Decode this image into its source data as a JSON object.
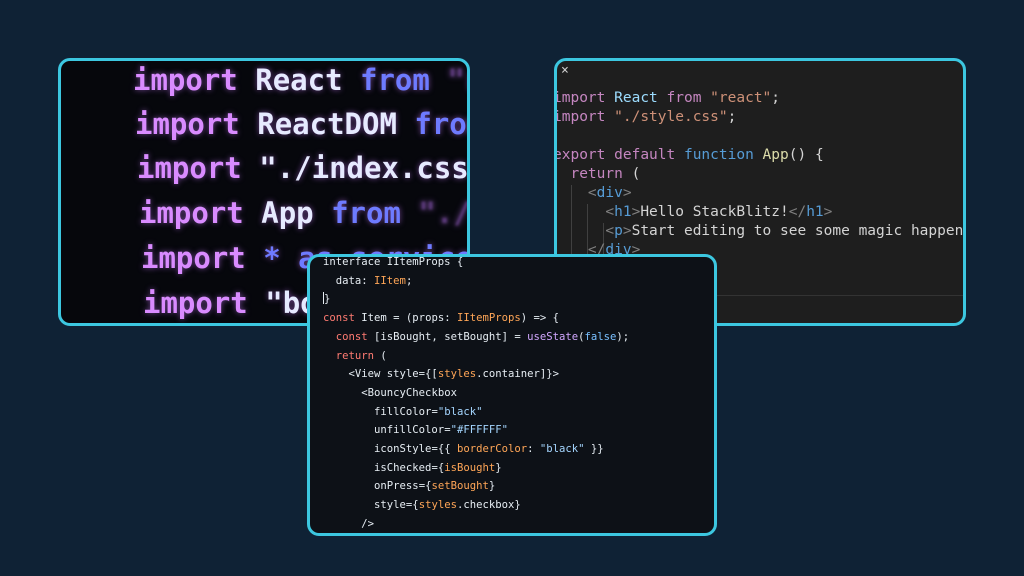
{
  "photo": {
    "lines": [
      {
        "kw": "import",
        "id": "React",
        "tail": "from",
        "dim": "\"rea"
      },
      {
        "kw": "import",
        "id": "ReactDOM",
        "tail": "from",
        "dim": ""
      },
      {
        "kw": "import",
        "id": "\"./index.css\"",
        "tail": "",
        "dim": ";"
      },
      {
        "kw": "import",
        "id": "App",
        "tail": "from",
        "dim": "\"./App"
      },
      {
        "kw": "import",
        "id": "* as",
        "tail": "service",
        "dim": ""
      },
      {
        "kw": "import",
        "id": "\"boo",
        "tail": "",
        "dim": ""
      }
    ]
  },
  "editor": {
    "close_label": "×",
    "lines": {
      "l1_kw": "import",
      "l1_id": "React",
      "l1_from": "from",
      "l1_str": "\"react\"",
      "l1_end": ";",
      "l2_kw": "import",
      "l2_str": "\"./style.css\"",
      "l2_end": ";",
      "l4_kw1": "export",
      "l4_kw2": "default",
      "l4_kw3": "function",
      "l4_fn": "App",
      "l4_end": "() {",
      "l5_kw": "return",
      "l5_end": " (",
      "l6_open": "<",
      "l6_tag": "div",
      "l6_close": ">",
      "l7_open": "<",
      "l7_tag": "h1",
      "l7_close": ">",
      "l7_text": "Hello StackBlitz!",
      "l7_open2": "</",
      "l7_tag2": "h1",
      "l7_close2": ">",
      "l8_open": "<",
      "l8_tag": "p",
      "l8_close": ">",
      "l8_text": "Start editing to see some magic happen",
      "l9_open": "</",
      "l9_tag": "div",
      "l9_close": ">"
    }
  },
  "front": {
    "l1": "interface IItemProps {",
    "l2_key": "data",
    "l2_type": "IItem",
    "l2_end": ";",
    "l3": "}",
    "l4_kw": "const",
    "l4_name": "Item",
    "l4_mid": " = (props: ",
    "l4_type": "IItemProps",
    "l4_end": ") => {",
    "l5_kw": "const",
    "l5_mid": " [isBought, setBought] = ",
    "l5_fn": "useState",
    "l5_arg": "false",
    "l5_end": ");",
    "l6_kw": "return",
    "l6_end": " (",
    "l7_a": "<View style={[",
    "l7_b": "styles",
    "l7_c": ".container]}>",
    "l8": "<BouncyCheckbox",
    "l9_attr": "fillColor",
    "l9_val": "\"black\"",
    "l10_attr": "unfillColor",
    "l10_val": "\"#FFFFFF\"",
    "l11_attr": "iconStyle",
    "l11_a": "={{ ",
    "l11_key": "borderColor",
    "l11_b": ": ",
    "l11_val": "\"black\"",
    "l11_c": " }}",
    "l12_attr": "isChecked",
    "l12_val": "isBought",
    "l13_attr": "onPress",
    "l13_val": "setBought",
    "l14_attr": "style",
    "l14_val": "styles",
    "l14_end": ".checkbox}",
    "l15": "/>"
  },
  "colors": {
    "background": "#0f2235",
    "border": "#3cc7e0"
  }
}
